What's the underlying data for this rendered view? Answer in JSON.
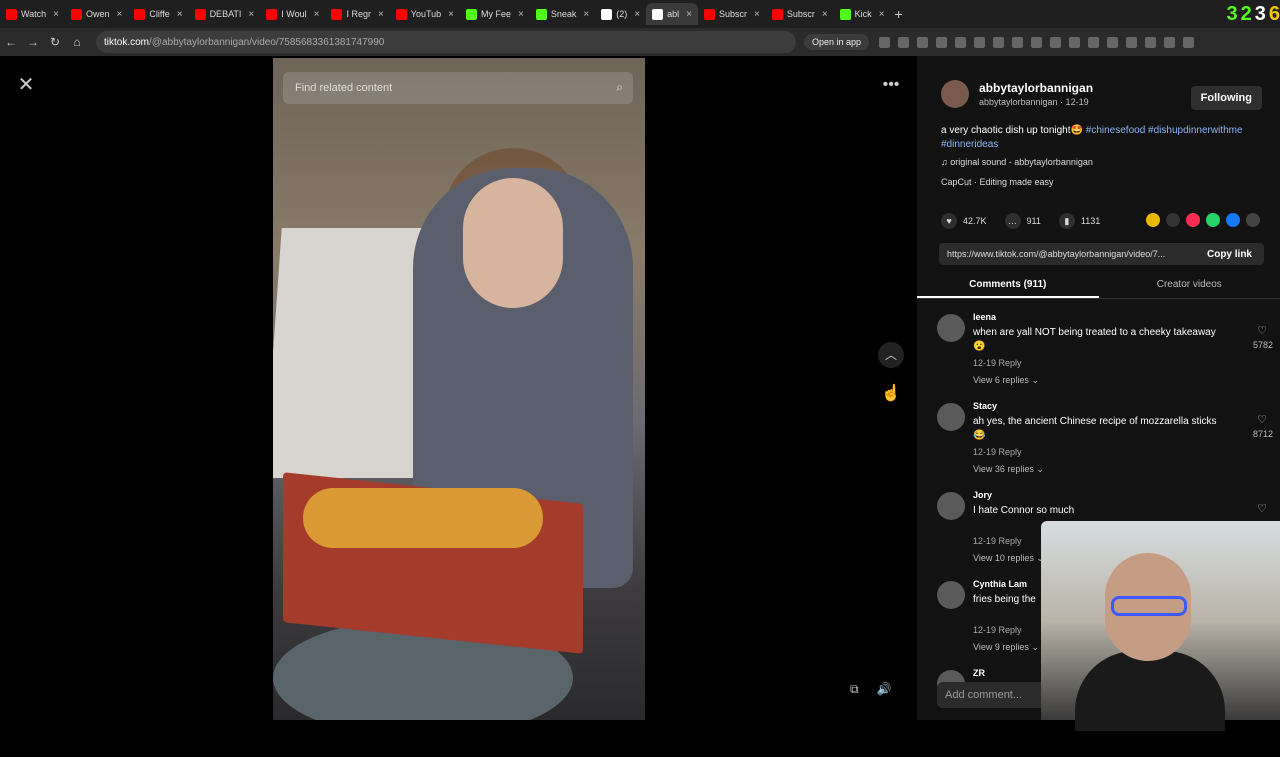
{
  "browser": {
    "tabs": [
      {
        "title": "Watch",
        "color": "#ff0000"
      },
      {
        "title": "Owen",
        "color": "#ff0000"
      },
      {
        "title": "Cliffe",
        "color": "#ff0000"
      },
      {
        "title": "DEBATI",
        "color": "#ff0000"
      },
      {
        "title": "I Woul",
        "color": "#ff0000"
      },
      {
        "title": "I Regr",
        "color": "#ff0000"
      },
      {
        "title": "YouTub",
        "color": "#ff0000"
      },
      {
        "title": "My Fee",
        "color": "#53fc18"
      },
      {
        "title": "Sneak",
        "color": "#53fc18"
      },
      {
        "title": "(2)",
        "color": "#ffffff"
      },
      {
        "title": "abl",
        "color": "#ffffff"
      },
      {
        "title": "Subscr",
        "color": "#ff0000"
      },
      {
        "title": "Subscr",
        "color": "#ff0000"
      },
      {
        "title": "Kick",
        "color": "#53fc18"
      }
    ],
    "url_host": "tiktok.com",
    "url_path": "/@abbytaylorbannigan/video/7585683361381747990",
    "open_in_app": "Open in app",
    "overlay_numbers": [
      "3",
      "2",
      "3",
      "6"
    ]
  },
  "video": {
    "search_placeholder": "Find related content"
  },
  "panel": {
    "author_name": "abbytaylorbannigan",
    "author_sub": "abbytaylorbannigan · 12-19",
    "follow_label": "Following",
    "desc_text": "a very chaotic dish up tonight🤩 ",
    "desc_tags": "#chinesefood #dishupdinnerwithme #dinnerideas",
    "sound": "♫  original sound - abbytaylorbannigan",
    "capcut": "CapCut · Editing made easy",
    "likes": "42.7K",
    "comments_count": "911",
    "saves": "1131",
    "link": "https://www.tiktok.com/@abbytaylorbannigan/video/7...",
    "copy_link": "Copy link",
    "tab_comments": "Comments (911)",
    "tab_creator": "Creator videos",
    "comments": [
      {
        "name": "leena",
        "text": "when are yall NOT being treated to a cheeky takeaway 😮",
        "meta": "12-19     Reply",
        "replies": "View 6 replies ⌄",
        "likes": "5782"
      },
      {
        "name": "Stacy",
        "text": "ah yes, the ancient Chinese recipe of mozzarella sticks 😂",
        "meta": "12-19     Reply",
        "replies": "View 36 replies ⌄",
        "likes": "8712"
      },
      {
        "name": "Jory",
        "text": "I hate Connor so much",
        "meta": "12-19     Reply",
        "replies": "View 10 replies ⌄",
        "likes": ""
      },
      {
        "name": "Cynthia Lam",
        "text": "fries being the",
        "meta": "12-19     Reply",
        "replies": "View 9 replies ⌄",
        "likes": ""
      },
      {
        "name": "ZR",
        "text": "",
        "meta": "",
        "replies": "",
        "likes": ""
      }
    ],
    "add_comment": "Add comment..."
  }
}
